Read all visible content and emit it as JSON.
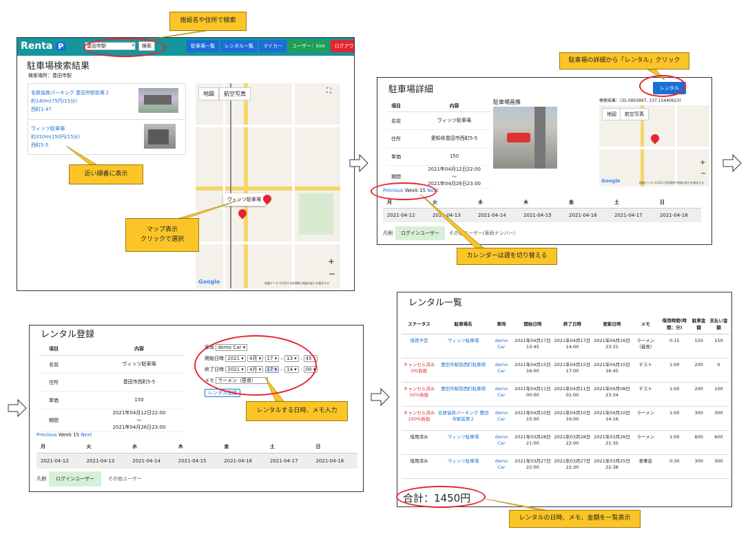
{
  "colors": {
    "accent": "#1a6fd6",
    "danger": "#e5262f",
    "callout": "#fbc527",
    "header": "#15959c"
  },
  "callouts": {
    "search": "施設名や住所で検索",
    "nearest": "近い順番に表示",
    "map": "マップ表示\nクリックで選択",
    "detail_rent": "駐車場の詳細から「レンタル」クリック",
    "calendar": "カレンダーは週を切り替える",
    "rental_input": "レンタルする日時、メモ入力",
    "rental_list": "レンタルの日時、メモ、金額を一覧表示"
  },
  "search_screen": {
    "logo_text": "Renta",
    "logo_p": "P",
    "search_value": "豊田市駅",
    "clear_label": "×",
    "search_button": "検索",
    "nav": [
      {
        "label": "駐車場一覧",
        "color": "#1a6fd6"
      },
      {
        "label": "レンタル一覧",
        "color": "#1a6fd6"
      },
      {
        "label": "マイカー",
        "color": "#1a6fd6"
      },
      {
        "label": "ユーザー：kim",
        "color": "#1e9e55"
      },
      {
        "label": "ログアウト",
        "color": "#e5262f"
      }
    ],
    "title": "駐車場検索結果",
    "search_place": "検索場所：豊田市駅",
    "results": [
      {
        "line1": "名鉄協商パーキング 豊田市駅前第２",
        "line2": "約140m(75円/15分)",
        "line3": "西町1-47"
      },
      {
        "line1": "ヴィッツ駐車場",
        "line2": "約310m(150円/15分)",
        "line3": "西町5-5"
      }
    ],
    "map_tabs": [
      "地図",
      "航空写真"
    ],
    "map_popup": "ヴィッツ駐車場",
    "map_google": "Google",
    "map_footer": "地図データ ©2021  利用規約  地図の誤りを報告する"
  },
  "detail_screen": {
    "title": "駐車場詳細",
    "rent_button": "レンタル",
    "col_item": "項目",
    "col_content": "内容",
    "rows": [
      {
        "k": "名前",
        "v": "ヴィッツ駐車場"
      },
      {
        "k": "住所",
        "v": "愛知県豊田市西町5-5"
      },
      {
        "k": "単価",
        "v": "150"
      },
      {
        "k": "期間",
        "v": "2021年04月12日22:00\n〜\n2021年04月26日23:00"
      }
    ],
    "image_label": "駐車場画像",
    "search_result": "検索結果：(35.0850997, 137.15440623)",
    "map_tabs": [
      "地図",
      "航空写真"
    ],
    "map_google": "Google",
    "map_footer": "地図データ ©2021  利用規約  地図の誤りを報告する",
    "week_prev": "Previous",
    "week_label": "Week 15",
    "week_next": "Next",
    "days": [
      "月",
      "火",
      "水",
      "木",
      "金",
      "土",
      "日"
    ],
    "dates": [
      "2021-04-12",
      "2021-04-13",
      "2021-04-14",
      "2021-04-15",
      "2021-04-16",
      "2021-04-17",
      "2021-04-18"
    ],
    "legend_label": "凡例",
    "legend_login": "ログインユーザー",
    "legend_other": "その他ユーザー(車両ナンバー)"
  },
  "register_screen": {
    "title": "レンタル登録",
    "col_item": "項目",
    "col_content": "内容",
    "rows": [
      {
        "k": "名前",
        "v": "ヴィッツ駐車場"
      },
      {
        "k": "住所",
        "v": "豊田市西町5-5"
      },
      {
        "k": "単価",
        "v": "150"
      },
      {
        "k": "期間",
        "v": "2021年04月12日22:00\n〜\n2021年04月26日23:00"
      }
    ],
    "car_label": "車両",
    "car_value": "demo Car",
    "start_label": "開始日時",
    "end_label": "終了日時",
    "start": {
      "y": "2021",
      "m": "4月",
      "d": "17",
      "h": "13",
      "mi": "45"
    },
    "end": {
      "y": "2021",
      "m": "4月",
      "d": "17",
      "h": "14",
      "mi": "00"
    },
    "memo_label": "メモ",
    "memo_value": "ラーメン（昼食）",
    "submit": "レンタル登録",
    "week_prev": "Previous",
    "week_label": "Week 15",
    "week_next": "Next",
    "days": [
      "月",
      "火",
      "水",
      "木",
      "金",
      "土",
      "日"
    ],
    "dates": [
      "2021-04-12",
      "2021-04-13",
      "2021-04-14",
      "2021-04-15",
      "2021-04-16",
      "2021-04-17",
      "2021-04-18"
    ],
    "legend_label": "凡例",
    "legend_login": "ログインユーザー",
    "legend_other": "その他ユーザー"
  },
  "list_screen": {
    "title": "レンタル一覧",
    "headers": [
      "ステータス",
      "駐車場名",
      "車両",
      "開始日時",
      "終了日時",
      "更新日時",
      "メモ",
      "借用時間(時間：分)",
      "駐車金額",
      "支払い金額"
    ],
    "rows": [
      {
        "status": "借用予定",
        "sc": "link",
        "name": "ヴィッツ駐車場",
        "car": "demo Car",
        "start": "2021年04月17日13:45",
        "end": "2021年04月17日14:00",
        "upd": "2021年04月16日23:31",
        "memo": "ラーメン（昼食）",
        "time": "0:15",
        "fee": "150",
        "pay": "150"
      },
      {
        "status": "キャンセル済み 0%負担",
        "sc": "red",
        "name": "豊田市駅前西町駐車場",
        "car": "demo Car",
        "start": "2021年04月15日16:00",
        "end": "2021年04月15日17:00",
        "upd": "2021年04月10日16:45",
        "memo": "テスト",
        "time": "1:00",
        "fee": "200",
        "pay": "0"
      },
      {
        "status": "キャンセル済み 50%負担",
        "sc": "red",
        "name": "豊田市駅前西町駐車場",
        "car": "demo Car",
        "start": "2021年04月11日00:00",
        "end": "2021年04月11日01:00",
        "upd": "2021年04月08日23:34",
        "memo": "テスト",
        "time": "1:00",
        "fee": "200",
        "pay": "100"
      },
      {
        "status": "キャンセル済み 100%負担",
        "sc": "red",
        "name": "名鉄協商パーキング 豊田市駅前第２",
        "car": "demo Car",
        "start": "2021年04月10日15:00",
        "end": "2021年04月10日16:00",
        "upd": "2021年04月10日14:16",
        "memo": "ラーメン",
        "time": "1:00",
        "fee": "300",
        "pay": "300"
      },
      {
        "status": "借用済み",
        "sc": "plain",
        "name": "ヴィッツ駐車場",
        "car": "demo Car",
        "start": "2021年03月28日21:00",
        "end": "2021年03月28日22:00",
        "upd": "2021年03月26日21:35",
        "memo": "ラーメン",
        "time": "1:00",
        "fee": "600",
        "pay": "600"
      },
      {
        "status": "借用済み",
        "sc": "plain",
        "name": "ヴィッツ駐車場",
        "car": "demo Car",
        "start": "2021年03月27日22:00",
        "end": "2021年03月27日22:30",
        "upd": "2021年03月25日22:38",
        "memo": "食事会",
        "time": "0:30",
        "fee": "300",
        "pay": "300"
      }
    ],
    "total": "合計：1450円"
  }
}
